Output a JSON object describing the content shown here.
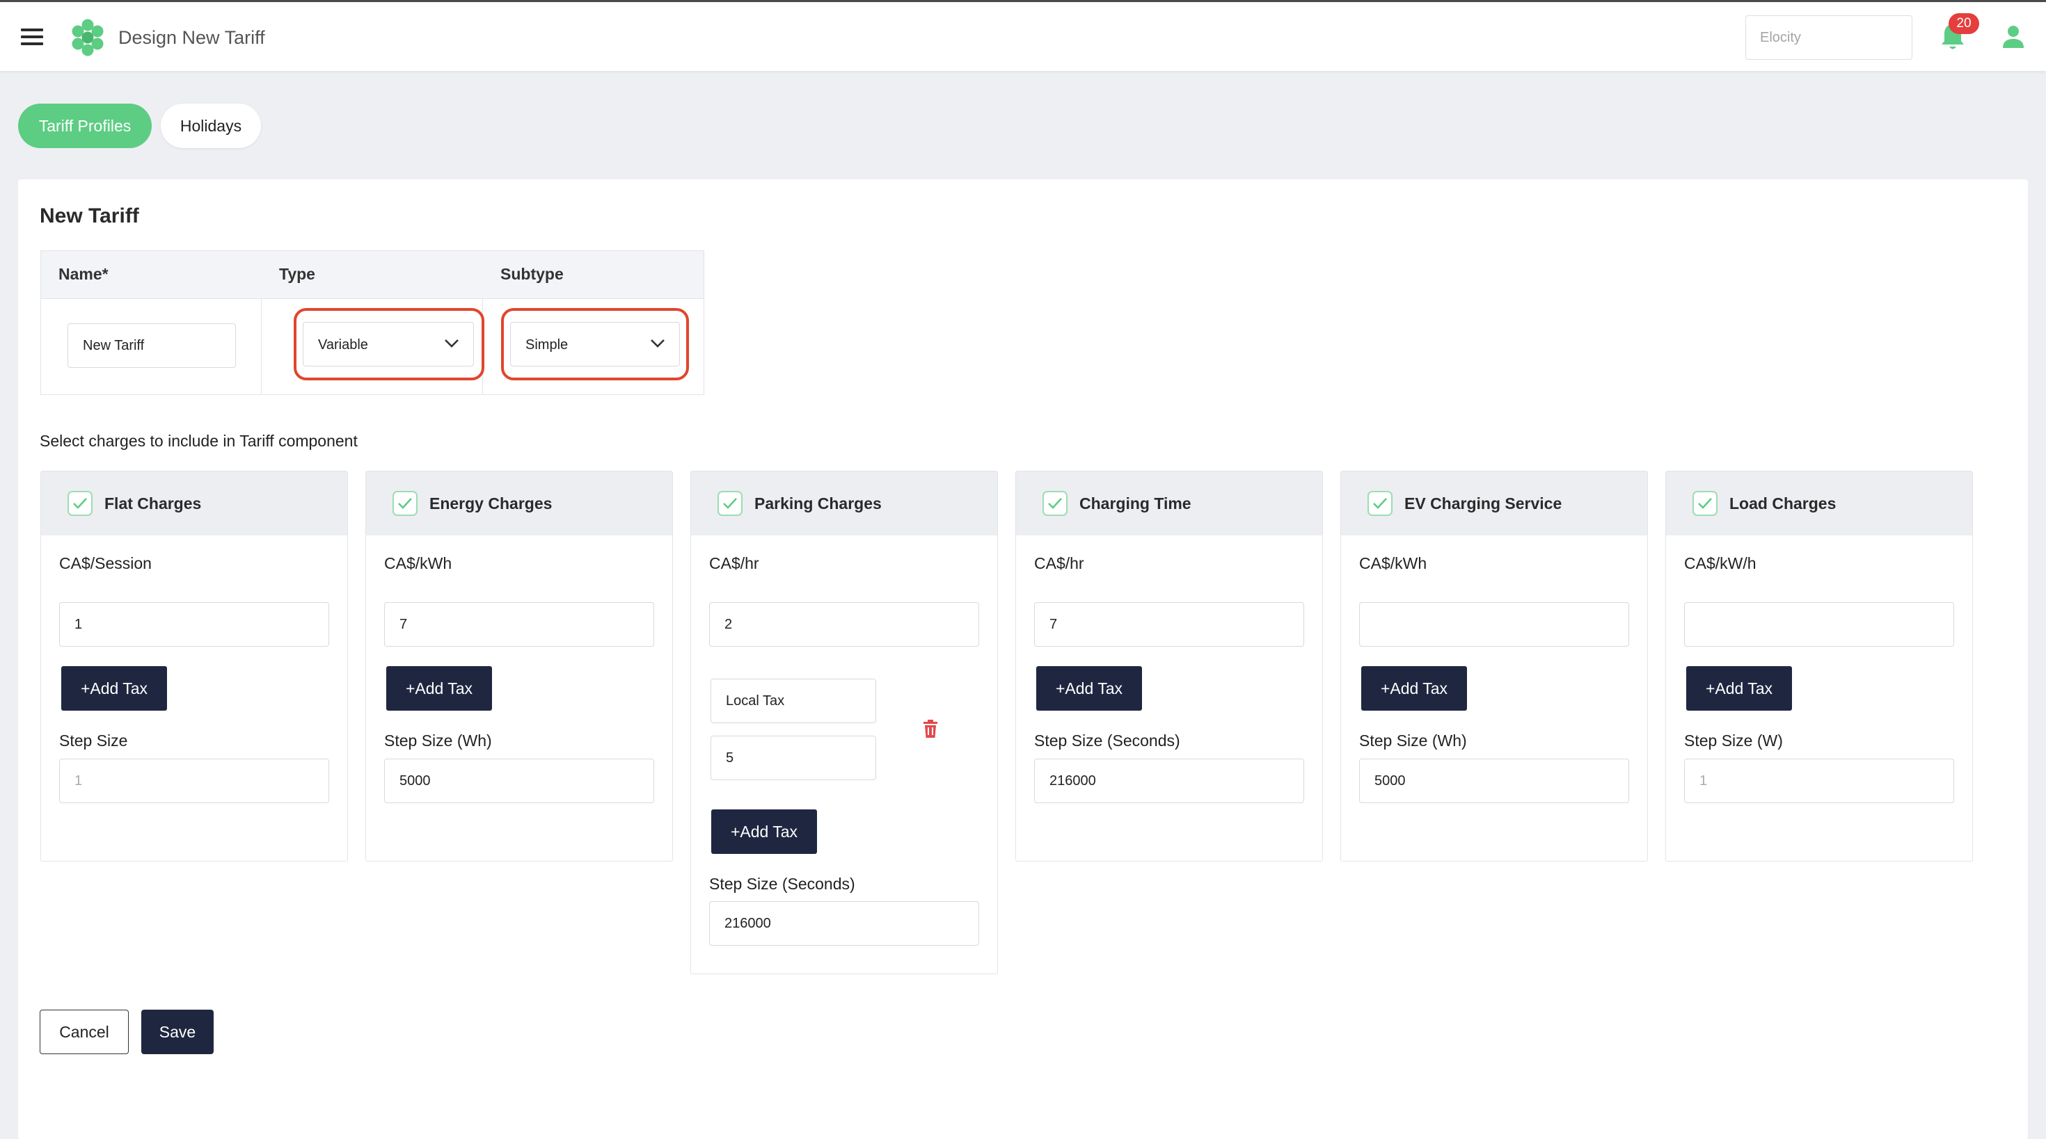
{
  "header": {
    "title": "Design New Tariff",
    "brand_placeholder": "Elocity",
    "notification_count": "20"
  },
  "tabs": [
    {
      "label": "Tariff Profiles",
      "active": true
    },
    {
      "label": "Holidays",
      "active": false
    }
  ],
  "form": {
    "title": "New Tariff",
    "columns": {
      "name": "Name*",
      "type": "Type",
      "subtype": "Subtype"
    },
    "name_value": "New Tariff",
    "type_value": "Variable",
    "subtype_value": "Simple"
  },
  "charges_label": "Select charges to include in Tariff component",
  "add_tax_label": "+Add Tax",
  "charges": [
    {
      "title": "Flat Charges",
      "unit": "CA$/Session",
      "value": "1",
      "step_label": "Step Size",
      "step_value": "",
      "step_placeholder": "1"
    },
    {
      "title": "Energy Charges",
      "unit": "CA$/kWh",
      "value": "7",
      "step_label": "Step Size (Wh)",
      "step_value": "5000",
      "step_placeholder": ""
    },
    {
      "title": "Parking Charges",
      "unit": "CA$/hr",
      "value": "2",
      "tax_name": "Local Tax",
      "tax_value": "5",
      "step_label": "Step Size (Seconds)",
      "step_value": "216000",
      "step_placeholder": ""
    },
    {
      "title": "Charging Time",
      "unit": "CA$/hr",
      "value": "7",
      "step_label": "Step Size (Seconds)",
      "step_value": "216000",
      "step_placeholder": ""
    },
    {
      "title": "EV Charging Service",
      "unit": "CA$/kWh",
      "value": "",
      "step_label": "Step Size (Wh)",
      "step_value": "5000",
      "step_placeholder": ""
    },
    {
      "title": "Load Charges",
      "unit": "CA$/kW/h",
      "value": "",
      "step_label": "Step Size (W)",
      "step_value": "",
      "step_placeholder": "1"
    }
  ],
  "actions": {
    "cancel": "Cancel",
    "save": "Save"
  },
  "colors": {
    "accent_green": "#5ccd83",
    "navy": "#1f2740",
    "highlight_red": "#e0462e",
    "badge_red": "#e53e3e"
  },
  "icons": [
    "menu-icon",
    "logo-icon",
    "bell-icon",
    "user-icon",
    "check-icon",
    "chevron-down-icon",
    "trash-icon"
  ]
}
